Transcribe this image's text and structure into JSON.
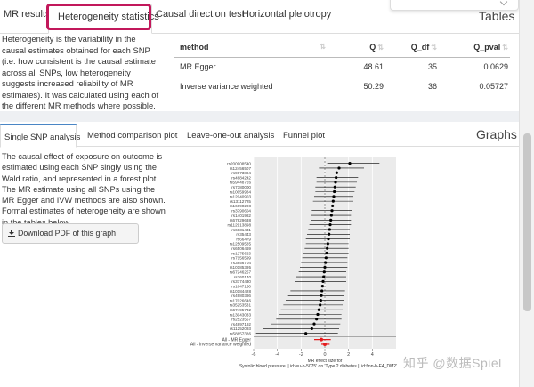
{
  "top_tabs": [
    "MR results",
    "Heterogeneity statistics",
    "Causal direction test",
    "Horizontal pleiotropy"
  ],
  "tables_title": "Tables",
  "heterogeneity_text": "Heterogeneity is the variability in the causal estimates obtained for each SNP (i.e. how consistent is the causal estimate across all SNPs, low heterogeneity suggests increased reliability of MR estimates). It was calculated using each of the different MR methods where possible.",
  "stats_table": {
    "headers": [
      "method",
      "Q",
      "Q_df",
      "Q_pval"
    ],
    "rows": [
      [
        "MR Egger",
        "48.61",
        "35",
        "0.0629"
      ],
      [
        "Inverse variance weighted",
        "50.29",
        "36",
        "0.05727"
      ]
    ]
  },
  "bottom_tabs": [
    "Single SNP analysis",
    "Method comparison plot",
    "Leave-one-out analysis",
    "Funnel plot"
  ],
  "graphs_title": "Graphs",
  "snp_text": "The causal effect of exposure on outcome is estimated using each SNP singly using the Wald ratio, and represented in a forest plot. The MR estimate using all SNPs using the MR Egger and IVW methods are also shown. Formal estimates of heterogeneity are shown in the tables below.",
  "download_label": "Download PDF of this graph",
  "chart_data": {
    "type": "scatter",
    "title": "",
    "xlabel": "MR effect size for 'Systolic blood pressure || id:ieu-b-5075' on 'Type 2 diabetes || id:finn-b-E4_DM2'",
    "ylabel": "",
    "xlim": [
      -6,
      6
    ],
    "x_ticks": [
      -6,
      -4,
      -2,
      0,
      2,
      4
    ],
    "grid": true,
    "snps": [
      "rs200908540",
      "rs12456507",
      "rs9073894",
      "rs4684242",
      "rs59448726",
      "rs7380000",
      "rs10059984",
      "rs12040903",
      "rs13112725",
      "rs16690298",
      "rs3790604",
      "rs1401982",
      "rs67829638",
      "rs112913898",
      "rs6031431",
      "rs35443",
      "rs66479",
      "rs12509585",
      "rs6506469",
      "rs1275623",
      "rs7156599",
      "rs3856704",
      "rs10185395",
      "rs67246257",
      "rs360140",
      "rs3774430",
      "rs1847150",
      "rs10184428",
      "rs4980386",
      "rs17026646",
      "rs35253531",
      "rs67495732",
      "rs13043033",
      "rs2523557",
      "rs4897192",
      "rs11252093",
      "rs58657386"
    ],
    "estimates": [
      2.1,
      1.2,
      1.0,
      0.95,
      0.9,
      0.85,
      0.8,
      0.75,
      0.7,
      0.65,
      0.6,
      0.55,
      0.5,
      0.45,
      0.4,
      0.35,
      0.3,
      0.25,
      0.2,
      0.15,
      0.1,
      0.05,
      0.0,
      -0.05,
      -0.1,
      -0.15,
      -0.2,
      -0.25,
      -0.3,
      -0.35,
      -0.4,
      -0.5,
      -0.6,
      -0.7,
      -0.9,
      -1.1,
      -1.6
    ],
    "ci_low": [
      0.2,
      -0.5,
      -0.6,
      -0.7,
      -0.7,
      -0.8,
      -0.8,
      -0.9,
      -1.0,
      -1.0,
      -1.1,
      -1.2,
      -1.2,
      -1.3,
      -1.4,
      -1.5,
      -1.6,
      -1.6,
      -1.7,
      -1.8,
      -1.9,
      -2.0,
      -2.1,
      -2.2,
      -2.4,
      -2.5,
      -2.7,
      -2.9,
      -3.1,
      -3.3,
      -3.5,
      -3.7,
      -3.9,
      -4.1,
      -4.5,
      -5.2,
      -5.8
    ],
    "ci_high": [
      4.6,
      3.3,
      3.0,
      2.8,
      2.7,
      2.6,
      2.5,
      2.4,
      2.4,
      2.3,
      2.3,
      2.2,
      2.2,
      2.2,
      2.1,
      2.1,
      2.1,
      2.0,
      2.0,
      2.0,
      1.9,
      1.9,
      1.9,
      1.8,
      1.8,
      1.8,
      1.7,
      1.7,
      1.6,
      1.6,
      1.5,
      1.5,
      1.4,
      1.4,
      1.3,
      1.2,
      1.1
    ],
    "summary": [
      {
        "name": "All - MR Egger",
        "value": -0.3,
        "low": -0.9,
        "high": 0.5
      },
      {
        "name": "All - Inverse variance weighted",
        "value": 0.0,
        "low": -0.3,
        "high": 0.4
      }
    ],
    "colors": {
      "snp": "#000000",
      "summary": "#e41a1c",
      "panel": "#ebebeb"
    }
  }
}
